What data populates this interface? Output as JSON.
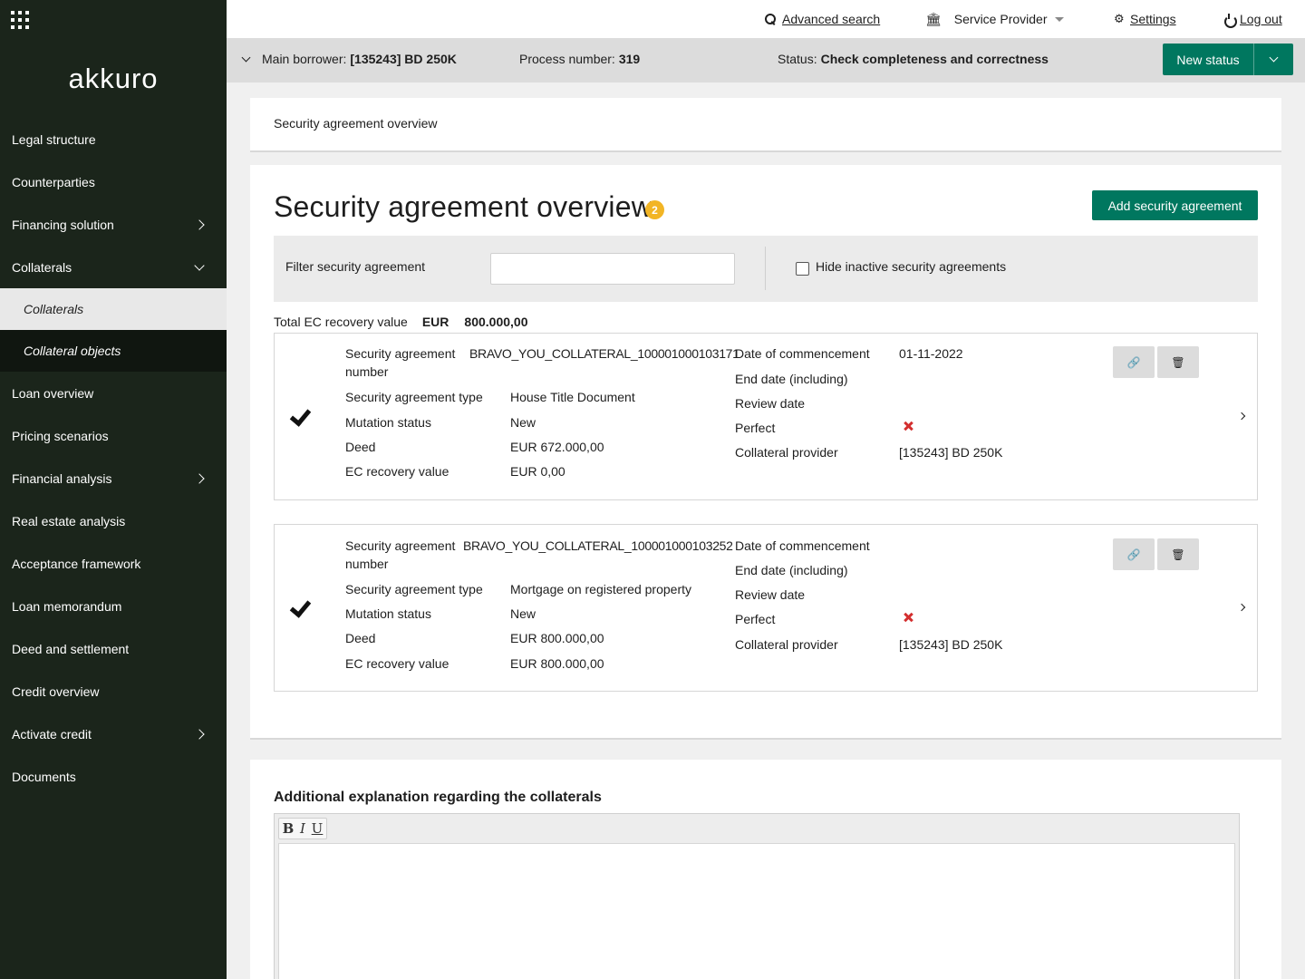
{
  "brand": {
    "logo_text": "akkuro"
  },
  "sidebar": {
    "items": [
      {
        "label": "Legal structure"
      },
      {
        "label": "Counterparties"
      },
      {
        "label": "Financing solution"
      },
      {
        "label": "Collaterals"
      },
      {
        "label": "Collaterals"
      },
      {
        "label": "Collateral objects"
      },
      {
        "label": "Loan overview"
      },
      {
        "label": "Pricing scenarios"
      },
      {
        "label": "Financial analysis"
      },
      {
        "label": "Real estate analysis"
      },
      {
        "label": "Acceptance framework"
      },
      {
        "label": "Loan memorandum"
      },
      {
        "label": "Deed and settlement"
      },
      {
        "label": "Credit overview"
      },
      {
        "label": "Activate credit"
      },
      {
        "label": "Documents"
      }
    ]
  },
  "topbar": {
    "advanced_search": "Advanced search",
    "service_provider": "Service Provider",
    "settings": "Settings",
    "logout": "Log out"
  },
  "infobar": {
    "borrower_label": "Main borrower:",
    "borrower_value": "[135243] BD 250K",
    "process_label": "Process number:",
    "process_value": "319",
    "status_label": "Status:",
    "status_value": "Check completeness and correctness",
    "new_status_button": "New status"
  },
  "breadcrumb": "Security agreement overview",
  "main": {
    "title": "Security agreement overview",
    "count_badge": "2",
    "add_button": "Add security agreement",
    "filter_label": "Filter security agreement",
    "filter_value": "",
    "hide_inactive_label": "Hide inactive security agreements",
    "hide_inactive_checked": false,
    "total_label": "Total EC recovery value",
    "total_currency": "EUR",
    "total_amount": "800.000,00"
  },
  "labels": {
    "number_line1": "Security agreement",
    "number_line2": "number",
    "type": "Security agreement type",
    "mutation": "Mutation status",
    "deed": "Deed",
    "ec_recovery": "EC recovery value",
    "commencement": "Date of commencement",
    "end_date": "End date (including)",
    "review_date": "Review date",
    "perfect": "Perfect",
    "provider": "Collateral provider"
  },
  "agreements": [
    {
      "number": "BRAVO_YOU_COLLATERAL_100001000103171",
      "type": "House Title Document",
      "mutation_status": "New",
      "deed": "EUR 672.000,00",
      "ec_recovery_value": "EUR 0,00",
      "date_of_commencement": "01-11-2022",
      "end_date": "",
      "review_date": "",
      "perfect": false,
      "collateral_provider": "[135243] BD 250K"
    },
    {
      "number": "BRAVO_YOU_COLLATERAL_100001000103252",
      "type": "Mortgage on registered property",
      "mutation_status": "New",
      "deed": "EUR 800.000,00",
      "ec_recovery_value": "EUR 800.000,00",
      "date_of_commencement": "",
      "end_date": "",
      "review_date": "",
      "perfect": false,
      "collateral_provider": "[135243] BD 250K"
    }
  ],
  "explanation": {
    "title": "Additional explanation regarding the collaterals",
    "text": "",
    "tools": {
      "bold": "B",
      "italic": "I",
      "underline": "U"
    }
  },
  "colors": {
    "sidebar": "#1b251b",
    "accent": "#00775f",
    "badge": "#f2b525",
    "error": "#d32f2f"
  }
}
